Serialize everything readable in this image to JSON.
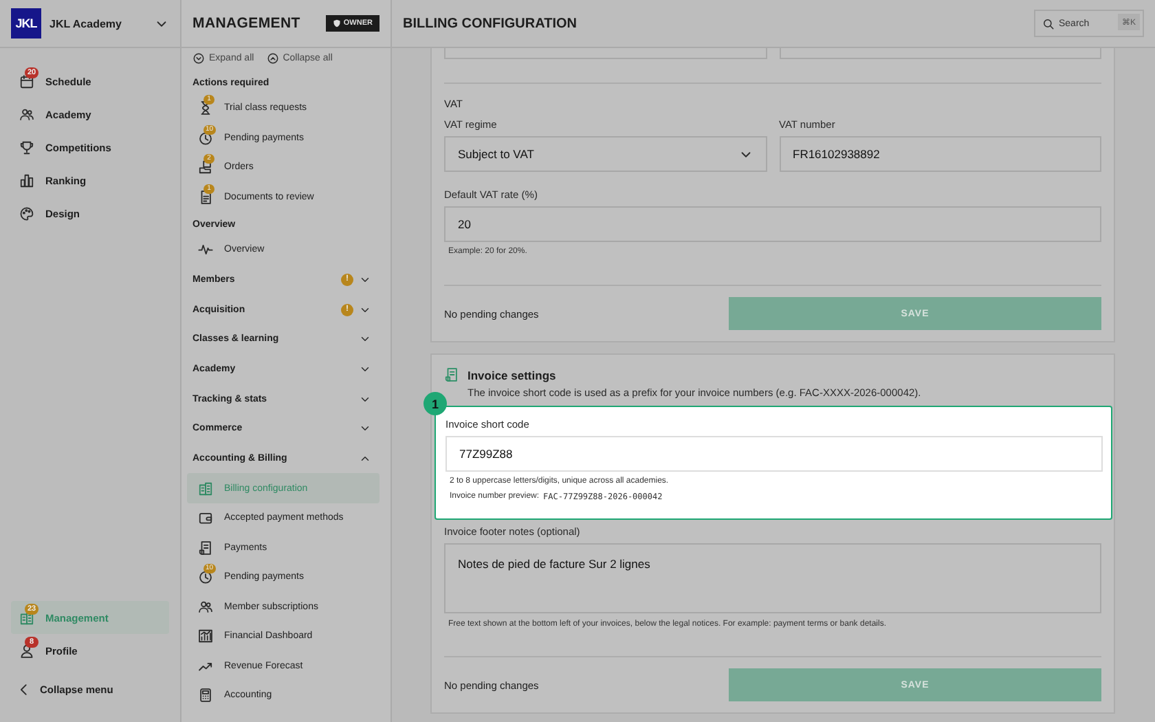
{
  "org": {
    "logo": "JKL",
    "name": "JKL Academy"
  },
  "nav": [
    {
      "label": "Schedule",
      "kind": "calendar",
      "badge": "20",
      "color": "#b8322a",
      "selected": false
    },
    {
      "label": "Academy",
      "kind": "people",
      "selected": false
    },
    {
      "label": "Competitions",
      "kind": "trophy",
      "selected": false
    },
    {
      "label": "Ranking",
      "kind": "bars",
      "selected": false
    },
    {
      "label": "Design",
      "kind": "palette",
      "selected": false
    }
  ],
  "nav_bottom": [
    {
      "label": "Management",
      "kind": "building",
      "badge": "23",
      "color": "#b8861c",
      "selected": true
    },
    {
      "label": "Profile",
      "kind": "person",
      "badge": "8",
      "color": "#b8322a",
      "selected": false
    }
  ],
  "collapse_menu": "Collapse menu",
  "panel": {
    "title": "MANAGEMENT",
    "role": "OWNER",
    "expand_all": "Expand all",
    "collapse_all": "Collapse all",
    "sections": [
      {
        "kind": "group",
        "label": "Actions required",
        "items": [
          {
            "label": "Trial class requests",
            "kind": "hourglass",
            "badge": "1",
            "selected": false
          },
          {
            "label": "Pending payments",
            "kind": "clock",
            "badge": "10",
            "selected": false
          },
          {
            "label": "Orders",
            "kind": "box",
            "badge": "2",
            "selected": false
          },
          {
            "label": "Documents to review",
            "kind": "doc",
            "badge": "1",
            "selected": false
          }
        ]
      },
      {
        "kind": "group",
        "label": "Overview",
        "items": [
          {
            "label": "Overview",
            "kind": "pulse",
            "selected": false
          }
        ]
      },
      {
        "kind": "accordion",
        "label": "Members",
        "badge": "!",
        "expanded": false
      },
      {
        "kind": "accordion",
        "label": "Acquisition",
        "badge": "!",
        "expanded": false
      },
      {
        "kind": "accordion",
        "label": "Classes & learning",
        "expanded": false
      },
      {
        "kind": "accordion",
        "label": "Academy",
        "expanded": false
      },
      {
        "kind": "accordion",
        "label": "Tracking & stats",
        "expanded": false
      },
      {
        "kind": "accordion",
        "label": "Commerce",
        "expanded": false
      },
      {
        "kind": "accordion",
        "label": "Accounting & Billing",
        "expanded": true,
        "items": [
          {
            "label": "Billing configuration",
            "kind": "building",
            "selected": true
          },
          {
            "label": "Accepted payment methods",
            "kind": "wallet",
            "selected": false
          },
          {
            "label": "Payments",
            "kind": "receipt",
            "selected": false
          },
          {
            "label": "Pending payments",
            "kind": "clock",
            "badge": "10",
            "selected": false
          },
          {
            "label": "Member subscriptions",
            "kind": "people",
            "selected": false
          },
          {
            "label": "Financial Dashboard",
            "kind": "dashboard",
            "selected": false
          },
          {
            "label": "Revenue Forecast",
            "kind": "trend",
            "selected": false
          },
          {
            "label": "Accounting",
            "kind": "calc",
            "selected": false
          }
        ]
      }
    ]
  },
  "page_title": "BILLING CONFIGURATION",
  "search": {
    "placeholder": "Search",
    "shortcut": "⌘K"
  },
  "vat_card": {
    "section": "VAT",
    "fields": [
      {
        "kind": "select",
        "label": "VAT regime",
        "value": "Subject to VAT"
      },
      {
        "kind": "text",
        "label": "VAT number",
        "value": "FR16102938892"
      },
      {
        "kind": "text",
        "label": "Default VAT rate (%)",
        "value": "20",
        "hint": "Example: 20 for 20%."
      }
    ],
    "status": "No pending changes",
    "button": {
      "label": "SAVE",
      "disabled": true
    }
  },
  "invoice_card": {
    "title": "Invoice settings",
    "description": "The invoice short code is used as a prefix for your invoice numbers (e.g. FAC-XXXX-2026-000042).",
    "fields": [
      {
        "kind": "text",
        "label": "Invoice short code",
        "value": "77Z99Z88",
        "hint": "2 to 8 uppercase letters/digits, unique across all academies.",
        "preview_label": "Invoice number preview:",
        "preview_value": "FAC-77Z99Z88-2026-000042",
        "highlighted": true,
        "step": "1"
      },
      {
        "kind": "textarea",
        "label": "Invoice footer notes (optional)",
        "value": "Notes de pied de facture Sur 2 lignes",
        "hint": "Free text shown at the bottom left of your invoices, below the legal notices. For example: payment terms or bank details."
      }
    ],
    "status": "No pending changes",
    "button": {
      "label": "SAVE",
      "disabled": true
    }
  }
}
